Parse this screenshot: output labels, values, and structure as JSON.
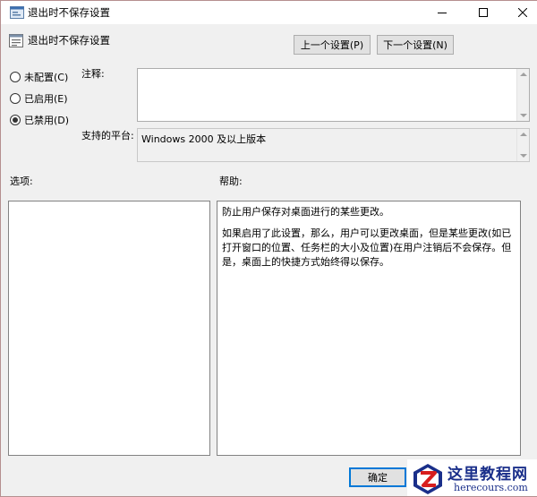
{
  "window": {
    "title": "退出时不保存设置",
    "controls": {
      "minimize": "minimize-icon",
      "maximize": "maximize-icon",
      "close": "close-icon"
    }
  },
  "header": {
    "setting_title": "退出时不保存设置",
    "prev_button": "上一个设置(P)",
    "next_button": "下一个设置(N)"
  },
  "radios": [
    {
      "label": "未配置(C)",
      "checked": false
    },
    {
      "label": "已启用(E)",
      "checked": false
    },
    {
      "label": "已禁用(D)",
      "checked": true
    }
  ],
  "comment": {
    "label": "注释:",
    "value": ""
  },
  "platform": {
    "label": "支持的平台:",
    "value": "Windows 2000 及以上版本"
  },
  "options": {
    "label": "选项:"
  },
  "help": {
    "label": "帮助:",
    "paragraph1": "防止用户保存对桌面进行的某些更改。",
    "paragraph2": "如果启用了此设置，那么，用户可以更改桌面，但是某些更改(如已打开窗口的位置、任务栏的大小及位置)在用户注销后不会保存。但是，桌面上的快捷方式始终得以保存。"
  },
  "footer": {
    "ok_button": "确定"
  },
  "watermark": {
    "title": "这里教程网",
    "url": "herecours.com"
  },
  "colors": {
    "accent": "#0078d7",
    "watermark": "#1a2f8a",
    "watermark_red": "#d81e1e"
  }
}
